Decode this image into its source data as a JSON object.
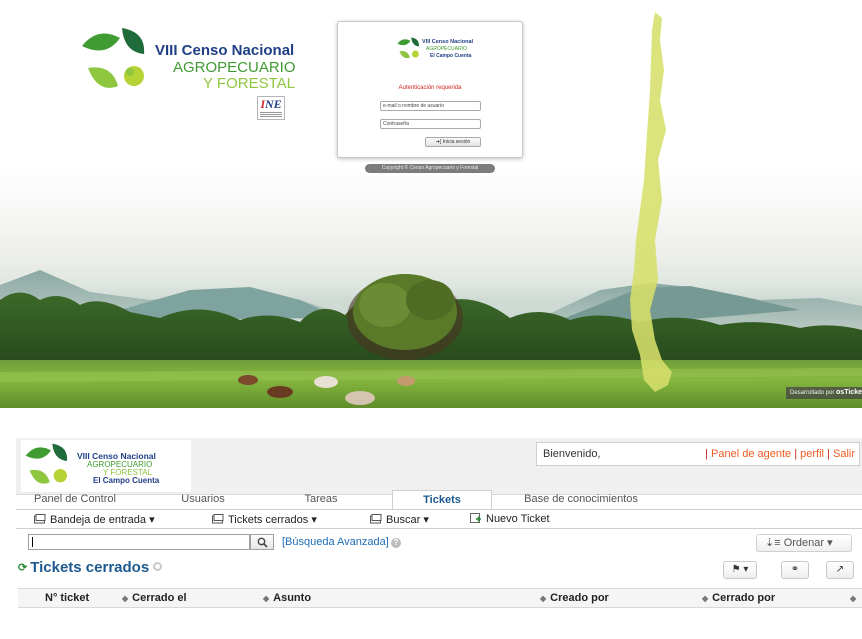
{
  "login": {
    "brand": {
      "line1": "VIII Censo Nacional",
      "line2": "AGROPECUARIO",
      "line3": "Y FORESTAL"
    },
    "ine_logo": "INE",
    "card": {
      "brand_line1": "VIII Censo Nacional",
      "brand_line2": "AGROPECUARIO",
      "brand_line3": "El Campo Cuenta",
      "auth_message": "Autenticación requerida",
      "username_placeholder": "e-mail o nombre de usuario",
      "password_placeholder": "Contraseña",
      "submit_label": "Inicia sesión"
    },
    "copyright": "Copyright © Censo Agropecuario y Forestal",
    "developed_by": "Desarrollado por",
    "developed_by_brand": "osTicket"
  },
  "header": {
    "logo": {
      "line1": "VIII Censo Nacional",
      "line2": "AGROPECUARIO",
      "line3": "Y FORESTAL",
      "line4": "El Campo Cuenta"
    },
    "welcome": "Bienvenido,",
    "links": {
      "agent_panel": "Panel de agente",
      "profile": "perfil",
      "logout": "Salir",
      "separator": "|"
    }
  },
  "nav_tabs": [
    {
      "label": "Panel de Control",
      "active": false
    },
    {
      "label": "Usuarios",
      "active": false
    },
    {
      "label": "Tareas",
      "active": false
    },
    {
      "label": "Tickets",
      "active": true
    },
    {
      "label": "Base de conocimientos",
      "active": false
    }
  ],
  "subnav": {
    "inbox": "Bandeja de entrada",
    "closed": "Tickets cerrados",
    "search": "Buscar",
    "new_ticket": "Nuevo Ticket"
  },
  "search": {
    "value": "",
    "advanced_label": "[Búsqueda Avanzada]",
    "sort_label": "Ordenar"
  },
  "list": {
    "title": "Tickets cerrados",
    "columns": [
      "N° ticket",
      "Cerrado el",
      "Asunto",
      "Creado por",
      "Cerrado por"
    ]
  },
  "colors": {
    "brand_blue": "#1f3f86",
    "brand_green": "#3f9b32",
    "brand_lime": "#8ec63f",
    "link_orange": "#f05a22",
    "title_blue": "#1e5a90"
  },
  "icons": [
    "search-icon",
    "refresh-icon",
    "gear-icon",
    "flag-icon",
    "link-icon",
    "share-icon",
    "sort-icon",
    "folder-icon",
    "new-ticket-icon",
    "help-icon",
    "login-icon"
  ]
}
